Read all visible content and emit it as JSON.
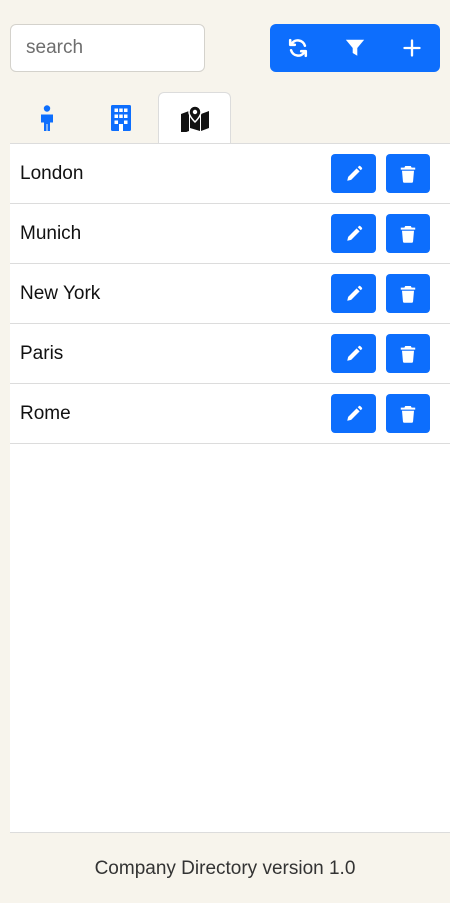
{
  "search": {
    "placeholder": "search"
  },
  "toolbar": {
    "buttons": [
      {
        "icon": "refresh-icon"
      },
      {
        "icon": "filter-icon"
      },
      {
        "icon": "plus-icon"
      }
    ],
    "color": "#0d6efd"
  },
  "tabs": [
    {
      "icon": "person-icon",
      "active": false
    },
    {
      "icon": "building-icon",
      "active": false
    },
    {
      "icon": "map-location-icon",
      "active": true
    }
  ],
  "locations": [
    {
      "name": "London"
    },
    {
      "name": "Munich"
    },
    {
      "name": "New York"
    },
    {
      "name": "Paris"
    },
    {
      "name": "Rome"
    }
  ],
  "footer": {
    "text": "Company Directory version 1.0"
  }
}
